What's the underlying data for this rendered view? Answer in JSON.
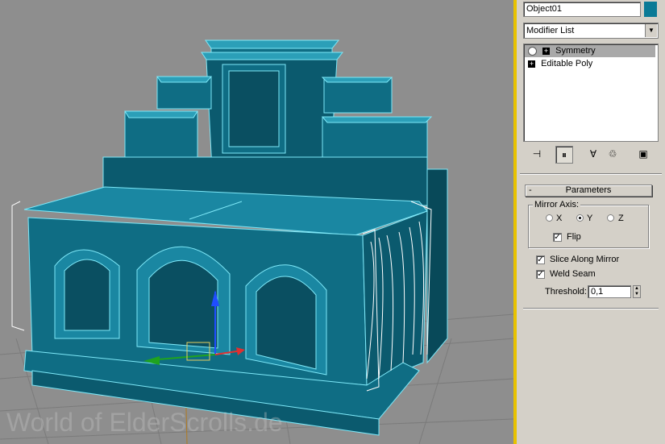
{
  "viewport": {
    "watermark": "World of ElderScrolls.de",
    "background": "#8e8e8e",
    "model_color": "#0f6d84",
    "active_border": "#e8c200"
  },
  "panel": {
    "object_name": "Object01",
    "object_color": "#0a7a96",
    "modifier_list": "Modifier List",
    "stack": [
      {
        "label": "Symmetry",
        "icon": "lightbulb-icon",
        "selected": true
      },
      {
        "label": "Editable Poly",
        "icon": "expand-icon",
        "selected": false
      }
    ],
    "toolbar": [
      {
        "icon": "pin-stack-icon",
        "glyph": "⊣"
      },
      {
        "icon": "show-end-result-icon",
        "glyph": "⏸"
      },
      {
        "icon": "make-unique-icon",
        "glyph": "∀"
      },
      {
        "icon": "remove-modifier-icon",
        "glyph": "♲"
      },
      {
        "icon": "configure-sets-icon",
        "glyph": "▣"
      }
    ],
    "parameters": {
      "title": "Parameters",
      "collapse": "-",
      "mirror_axis_label": "Mirror Axis:",
      "axes": [
        "X",
        "Y",
        "Z"
      ],
      "selected_axis": "Y",
      "flip_label": "Flip",
      "flip_checked": true,
      "slice_label": "Slice Along Mirror",
      "slice_checked": true,
      "weld_label": "Weld Seam",
      "weld_checked": true,
      "threshold_label": "Threshold:",
      "threshold_value": "0,1"
    }
  }
}
